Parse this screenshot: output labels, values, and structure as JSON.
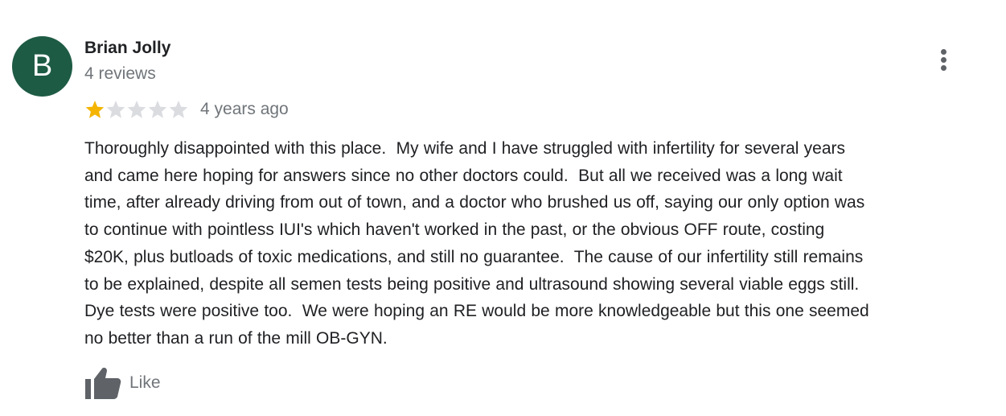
{
  "review": {
    "author": {
      "initial": "B",
      "name": "Brian Jolly",
      "reviews_count": "4 reviews",
      "avatar_color": "#1e5b45"
    },
    "rating": {
      "value": 1,
      "max": 5,
      "filled_color": "#f4b400",
      "empty_color": "#dadce0"
    },
    "time_ago": "4 years ago",
    "text_lines": [
      "Thoroughly disappointed with this place.  My wife and I have struggled with infertility for several years",
      "and came here hoping for answers since no other doctors could.  But all we received was a long wait",
      "time, after already driving from out of town, and a doctor who brushed us off, saying our only option was",
      "to continue with pointless IUI's which haven't worked in the past, or the obvious OFF route, costing",
      "$20K, plus butloads of toxic medications, and still no guarantee.  The cause of our infertility still remains",
      "to be explained, despite all semen tests being positive and ultrasound showing several viable eggs still.",
      "Dye tests were positive too.  We were hoping an RE would be more knowledgeable but this one seemed",
      "no better than a run of the mill OB-GYN."
    ],
    "like_label": "Like",
    "icons": {
      "more": "more-vert-icon",
      "star": "star-icon",
      "like": "thumb-up-icon"
    }
  }
}
